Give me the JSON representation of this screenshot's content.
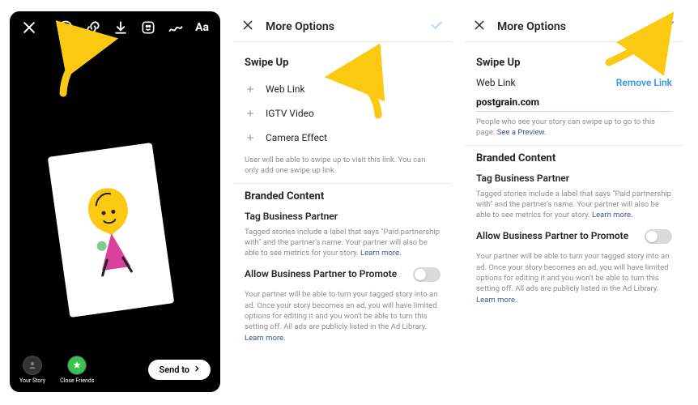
{
  "editor": {
    "icons": [
      "close-icon",
      "face-icon",
      "link-icon",
      "download-icon",
      "sticker-icon",
      "draw-icon",
      "text-icon"
    ],
    "tray": {
      "your_story": "Your Story",
      "close_friends": "Close Friends",
      "send_to": "Send to"
    }
  },
  "panel2": {
    "title": "More Options",
    "swipe_up_heading": "Swipe Up",
    "options": [
      {
        "label": "Web Link"
      },
      {
        "label": "IGTV Video"
      },
      {
        "label": "Camera Effect"
      }
    ],
    "swipe_help": "User will be able to swipe up to visit this link. You can only add one swipe up link.",
    "branded_heading": "Branded Content",
    "tag_partner_heading": "Tag Business Partner",
    "tag_partner_help": "Tagged stories include a label that says \"Paid partnership with\" and the partner's name. Your partner will also be able to see metrics for your story.",
    "learn_more": "Learn more.",
    "allow_promote_heading": "Allow Business Partner to Promote",
    "allow_promote_help": "Your partner will be able to turn your tagged story into an ad. Once your story becomes an ad, you will have limited options for editing it and you won't be able to turn this setting off. All ads are publicly listed in the Ad Library."
  },
  "panel3": {
    "title": "More Options",
    "swipe_up_heading": "Swipe Up",
    "weblink_label": "Web Link",
    "remove_link": "Remove Link",
    "weblink_value": "postgrain.com",
    "preview_help": "People who see your story can swipe up to go to this page.",
    "see_preview": "See a Preview.",
    "branded_heading": "Branded Content",
    "tag_partner_heading": "Tag Business Partner",
    "tag_partner_help": "Tagged stories include a label that says \"Paid partnership with\" and the partner's name. Your partner will also be able to see metrics for your story.",
    "learn_more": "Learn more.",
    "allow_promote_heading": "Allow Business Partner to Promote",
    "allow_promote_help": "Your partner will be able to turn your tagged story into an ad. Once your story becomes an ad, you will have limited options for editing it and you won't be able to turn this setting off. All ads are publicly listed in the Ad Library."
  },
  "colors": {
    "arrow": "#fbc912",
    "accent": "#3897f0"
  }
}
